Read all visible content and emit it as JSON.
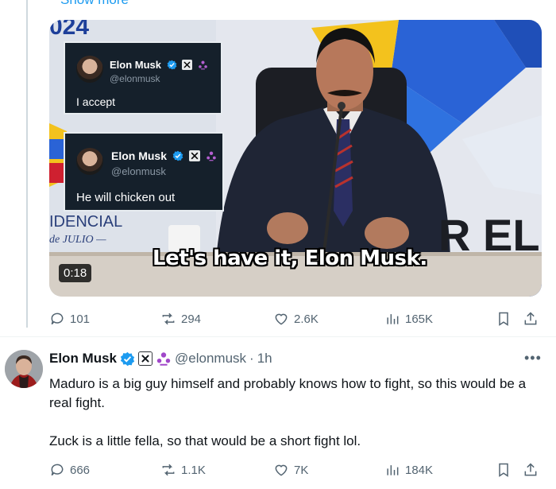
{
  "previous_tweet": {
    "show_more_label": "Show more",
    "video": {
      "duration": "0:18",
      "caption": "Let's have it, Elon Musk.",
      "backdrop_text": {
        "year": "024",
        "mid_left": "IDENCIAL",
        "low_left": "de JULIO —",
        "right": "R EL"
      },
      "overlay_cards": [
        {
          "name": "Elon Musk",
          "handle": "@elonmusk",
          "text": "I accept"
        },
        {
          "name": "Elon Musk",
          "handle": "@elonmusk",
          "text": "He will chicken out"
        }
      ]
    },
    "stats": {
      "replies": "101",
      "reposts": "294",
      "likes": "2.6K",
      "views": "165K"
    }
  },
  "reply_tweet": {
    "author_name": "Elon Musk",
    "handle": "@elonmusk",
    "separator": "·",
    "time": "1h",
    "more_label": "•••",
    "paragraphs": [
      "Maduro is a big guy himself and probably knows how to fight, so this would be a real fight.",
      "Zuck is a little fella, so that would be a short fight lol."
    ],
    "stats": {
      "replies": "666",
      "reposts": "1.1K",
      "likes": "7K",
      "views": "184K"
    }
  },
  "icons": {
    "verified": "verified-badge-icon",
    "affiliate": "x-logo-icon",
    "role": "people-icon",
    "reply": "comment-icon",
    "repost": "repost-icon",
    "like": "heart-icon",
    "views": "bar-chart-icon",
    "bookmark": "bookmark-icon",
    "share": "share-icon"
  },
  "colors": {
    "accent": "#1d9bf0",
    "text": "#0f1419",
    "secondary": "#536471",
    "role_badge": "#a047c9"
  }
}
